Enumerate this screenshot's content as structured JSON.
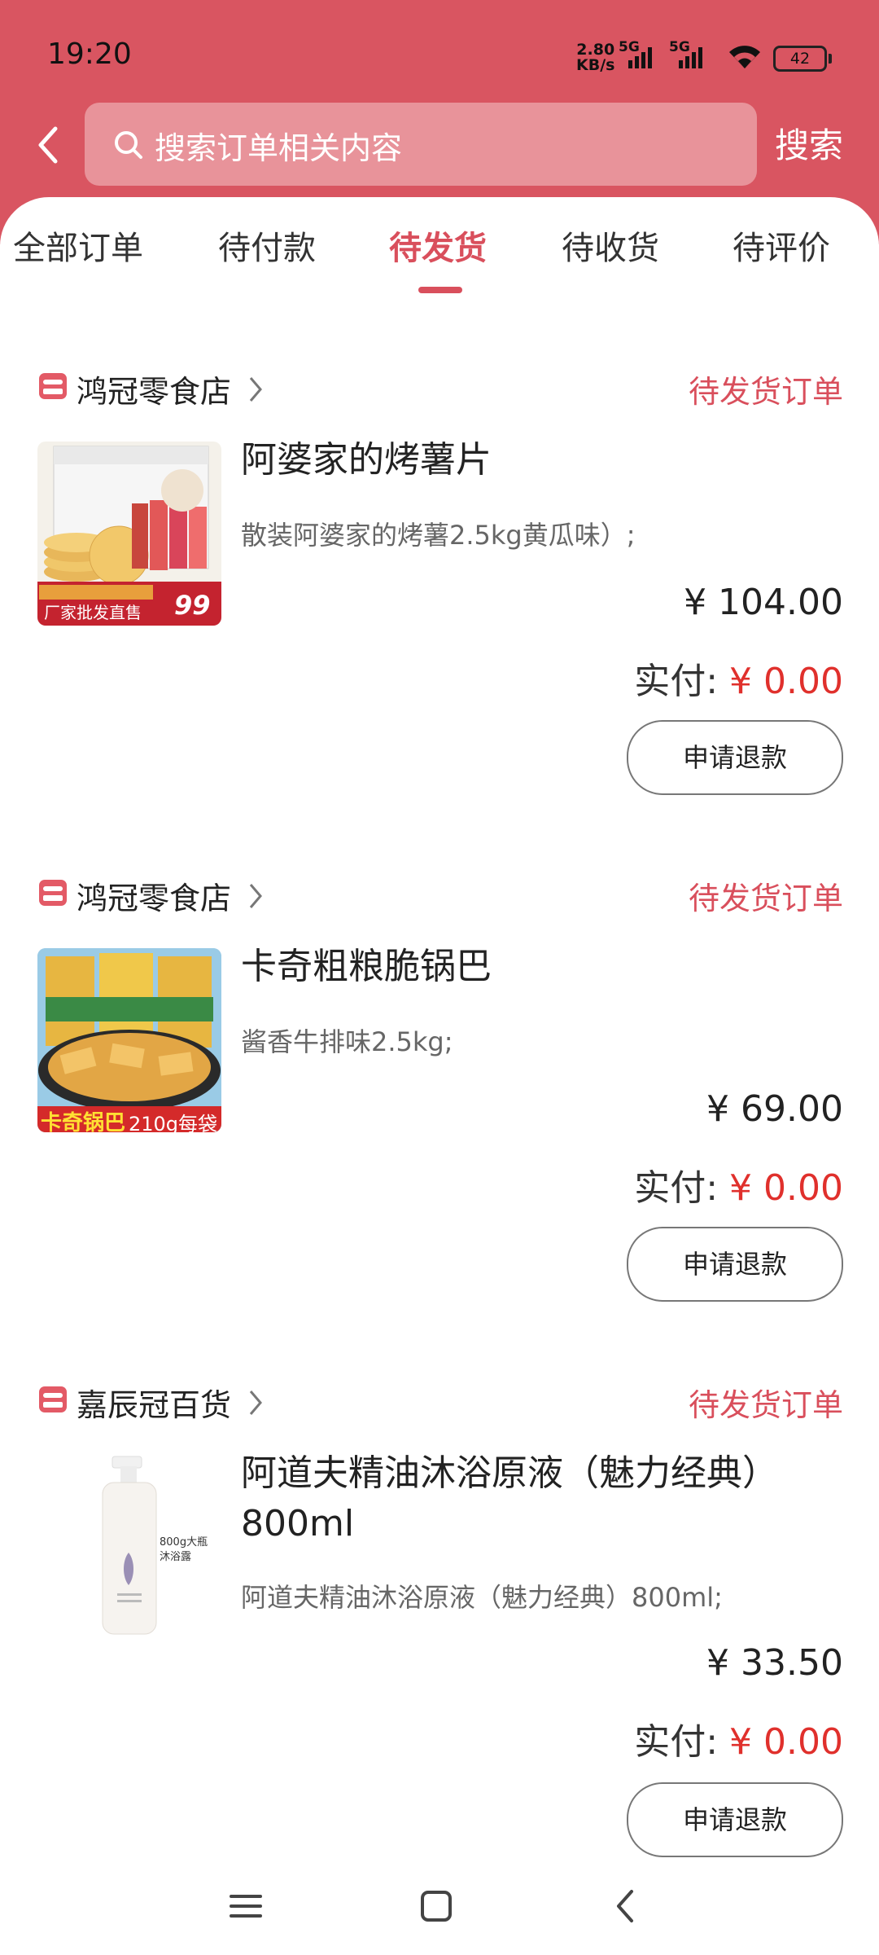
{
  "status_bar": {
    "time": "19:20",
    "speed_value": "2.80",
    "speed_unit": "KB/s",
    "network_1": "5G",
    "network_2": "5G",
    "battery": "42"
  },
  "header": {
    "search_placeholder": "搜索订单相关内容",
    "search_button": "搜索"
  },
  "tabs": [
    {
      "label": "全部订单",
      "active": false
    },
    {
      "label": "待付款",
      "active": false
    },
    {
      "label": "待发货",
      "active": true
    },
    {
      "label": "待收货",
      "active": false
    },
    {
      "label": "待评价",
      "active": false
    }
  ],
  "orders": [
    {
      "shop": "鸿冠零食店",
      "status": "待发货订单",
      "title": "阿婆家的烤薯片",
      "spec": "散装阿婆家的烤薯2.5kg黄瓜味）;",
      "price": "¥ 104.00",
      "paid_label": "实付:",
      "paid_amount": "¥ 0.00",
      "refund_button": "申请退款",
      "image_text_1": "厂家批发直售",
      "image_text_2": "99"
    },
    {
      "shop": "鸿冠零食店",
      "status": "待发货订单",
      "title": "卡奇粗粮脆锅巴",
      "spec": "酱香牛排味2.5kg;",
      "price": "¥ 69.00",
      "paid_label": "实付:",
      "paid_amount": "¥ 0.00",
      "refund_button": "申请退款",
      "image_text_1": "卡奇锅巴",
      "image_text_2": "210g每袋"
    },
    {
      "shop": "嘉辰冠百货",
      "status": "待发货订单",
      "title_line1": "阿道夫精油沐浴原液（魅力经典）",
      "title_line2": "800ml",
      "spec": "阿道夫精油沐浴原液（魅力经典）800ml;",
      "price": "¥ 33.50",
      "paid_label": "实付:",
      "paid_amount": "¥ 0.00",
      "refund_button": "申请退款",
      "image_text_1": "800g大瓶",
      "image_text_2": "沐浴露"
    }
  ],
  "colors": {
    "header_bg": "#d95561",
    "accent": "#d94f5c",
    "paid_red": "#e0302c"
  }
}
